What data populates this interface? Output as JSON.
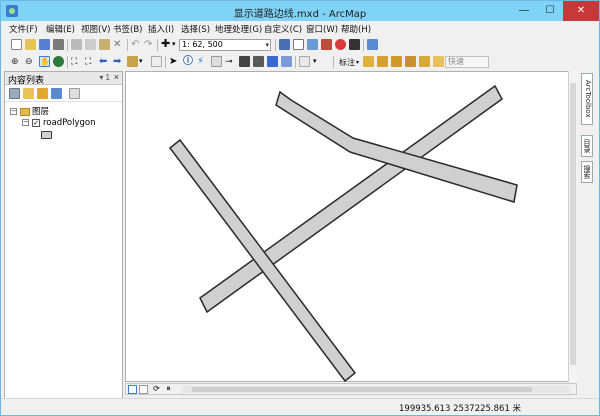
{
  "window": {
    "title": "显示道路边线.mxd - ArcMap"
  },
  "menu": [
    "文件(F)",
    "编辑(E)",
    "视图(V)",
    "书签(B)",
    "插入(I)",
    "选择(S)",
    "地理处理(G)",
    "自定义(C)",
    "窗口(W)",
    "帮助(H)"
  ],
  "toolbar": {
    "scale": "1: 62, 500",
    "labeling": "标注",
    "quick": "快速"
  },
  "toc": {
    "title": "内容列表",
    "pin": "▾ 1",
    "group": "图层",
    "layer": "roadPolygon"
  },
  "dock": {
    "toolbox": "ArcToolbox",
    "catalog": "目录",
    "search": "搜索"
  },
  "status": {
    "coordinates": "199935.613  2537225.861 米"
  },
  "colors": {
    "road_fill": "#d0d0d0",
    "road_stroke": "#2a2a2a",
    "titlebar": "#7fd3f7"
  }
}
